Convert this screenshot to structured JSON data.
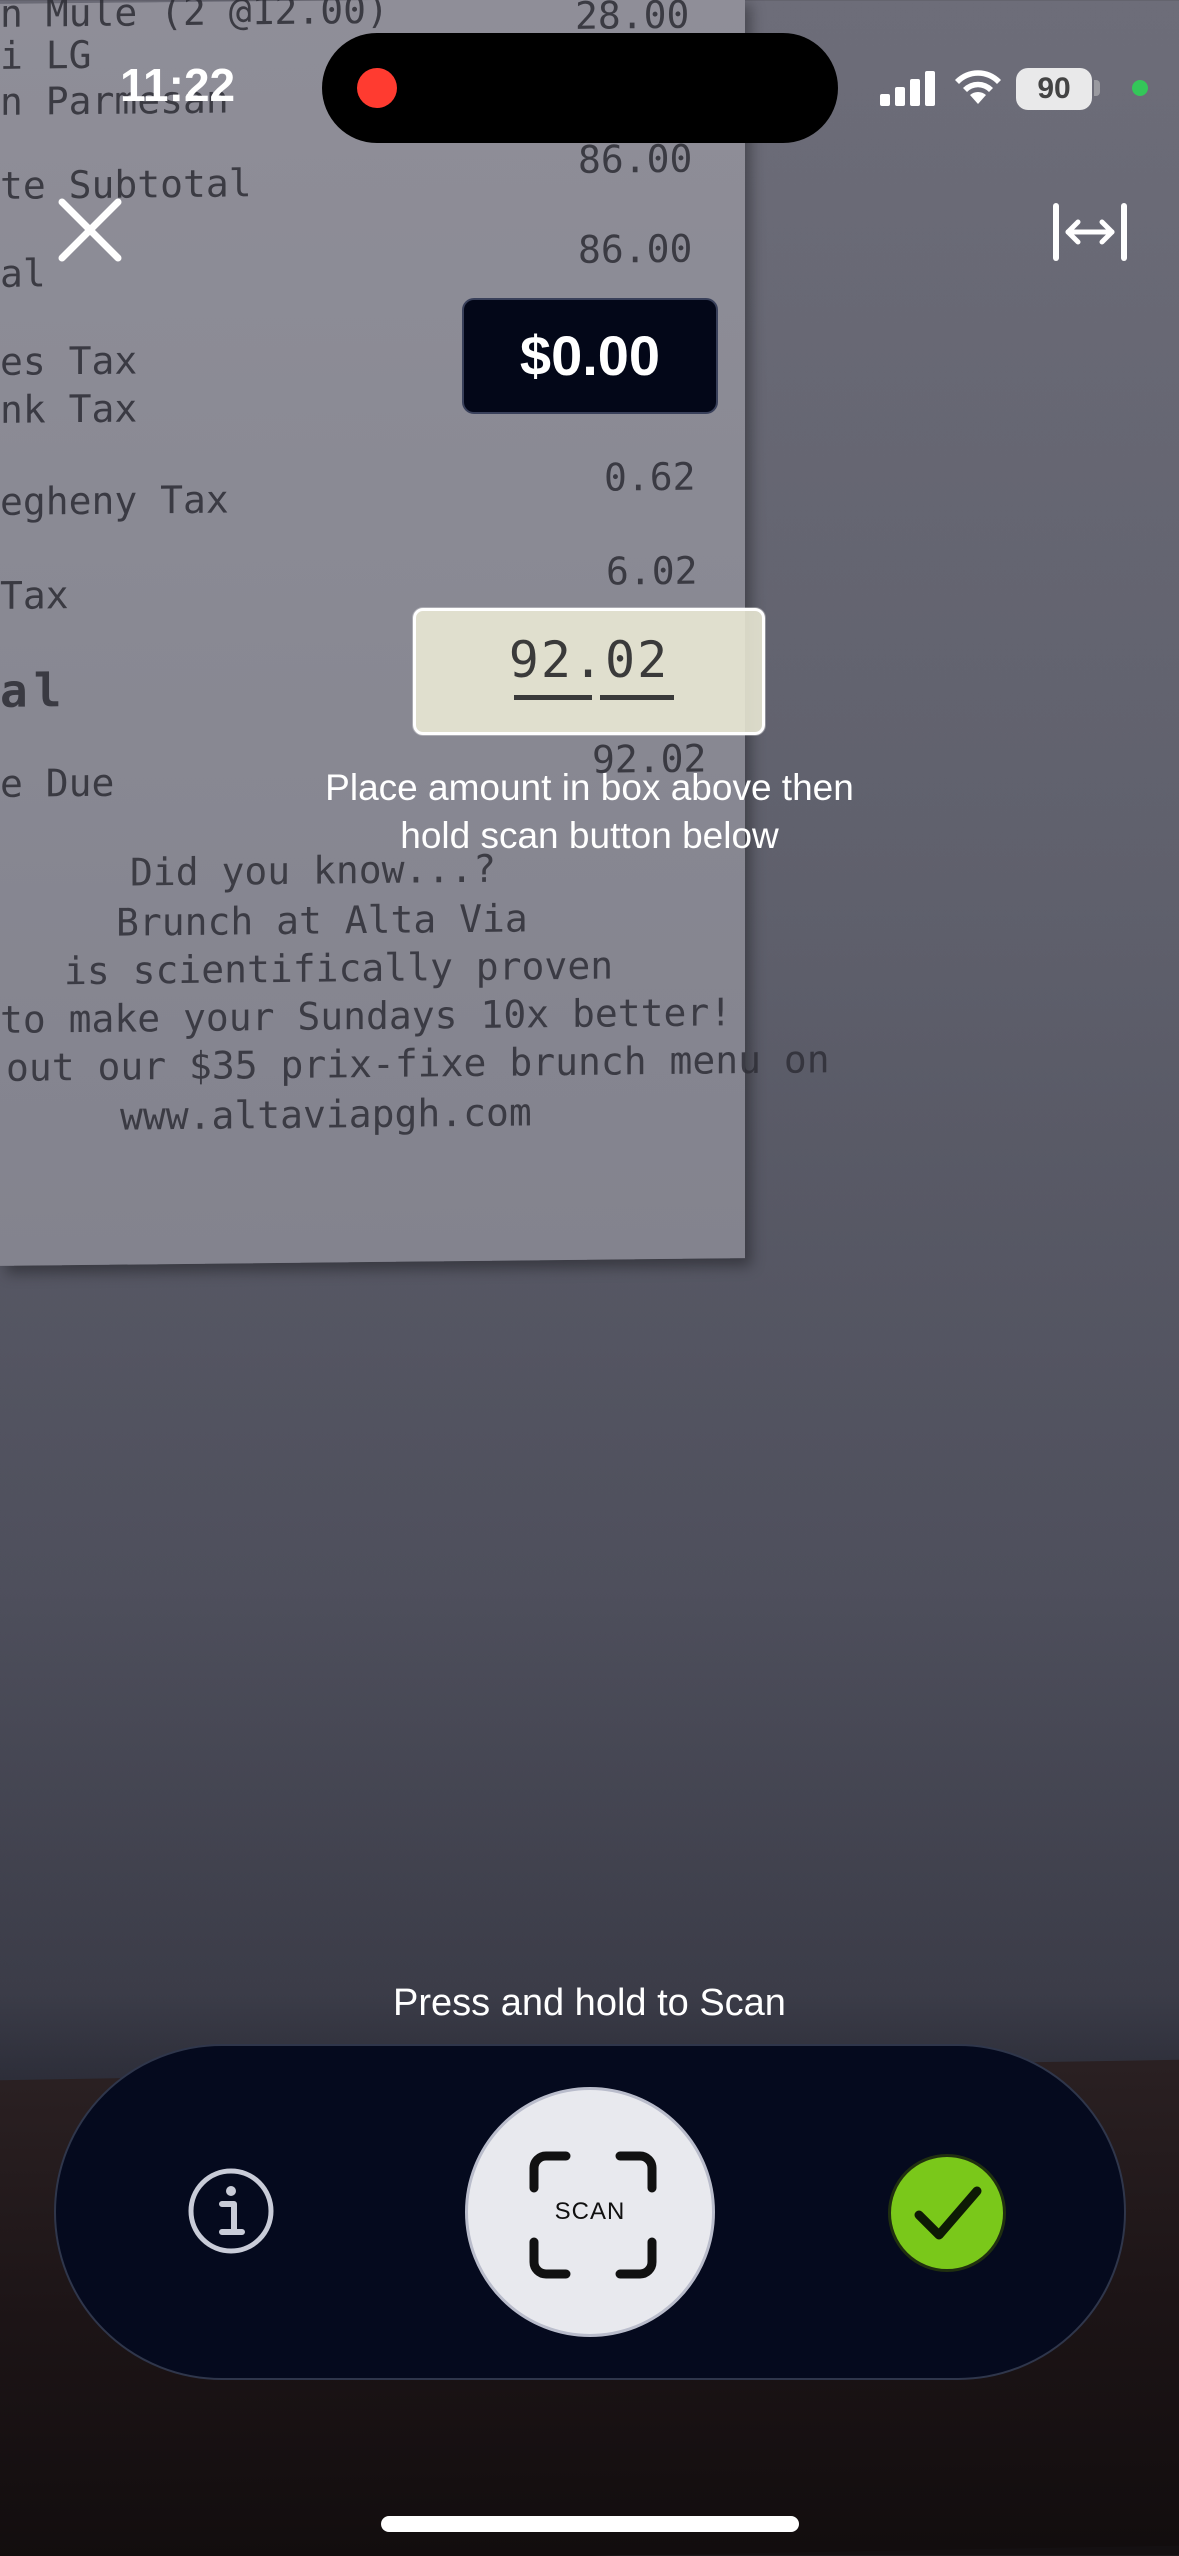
{
  "status_bar": {
    "time": "11:22",
    "battery": "90"
  },
  "receipt_background": {
    "lines": [
      {
        "text": "n Mule (2 @12.00)",
        "amount": "28.00"
      },
      {
        "text": "i LG",
        "amount": ""
      },
      {
        "text": "n Parmesan",
        "amount": ""
      },
      {
        "text": "te Subtotal",
        "amount": "86.00"
      },
      {
        "text": "al",
        "amount": "86.00"
      },
      {
        "text": "es Tax",
        "amount": ""
      },
      {
        "text": "nk Tax",
        "amount": ""
      },
      {
        "text": "egheny Tax",
        "amount": "0.62"
      },
      {
        "text": "Tax",
        "amount": "6.02"
      },
      {
        "text": "al",
        "amount": ""
      },
      {
        "text": "e Due",
        "amount": "92.02"
      }
    ],
    "promo": [
      "Did you know...?",
      "Brunch at Alta Via",
      "is scientifically proven",
      "to make your Sundays 10x better!",
      "out our $35 prix-fixe brunch menu on",
      "www.altaviapgh.com"
    ]
  },
  "header": {
    "scanned_amount": "$0.00"
  },
  "scan_frame": {
    "detected_value": "92.02"
  },
  "instructions": {
    "line1": "Place amount in box above then",
    "line2": "hold scan button below"
  },
  "controls": {
    "hint": "Press and hold to Scan",
    "scan_label": "SCAN",
    "info_icon": "info-icon",
    "confirm_icon": "checkmark-icon",
    "close_icon": "close-icon",
    "expand_icon": "expand-width-icon",
    "confirm_color": "#7ac81a"
  }
}
